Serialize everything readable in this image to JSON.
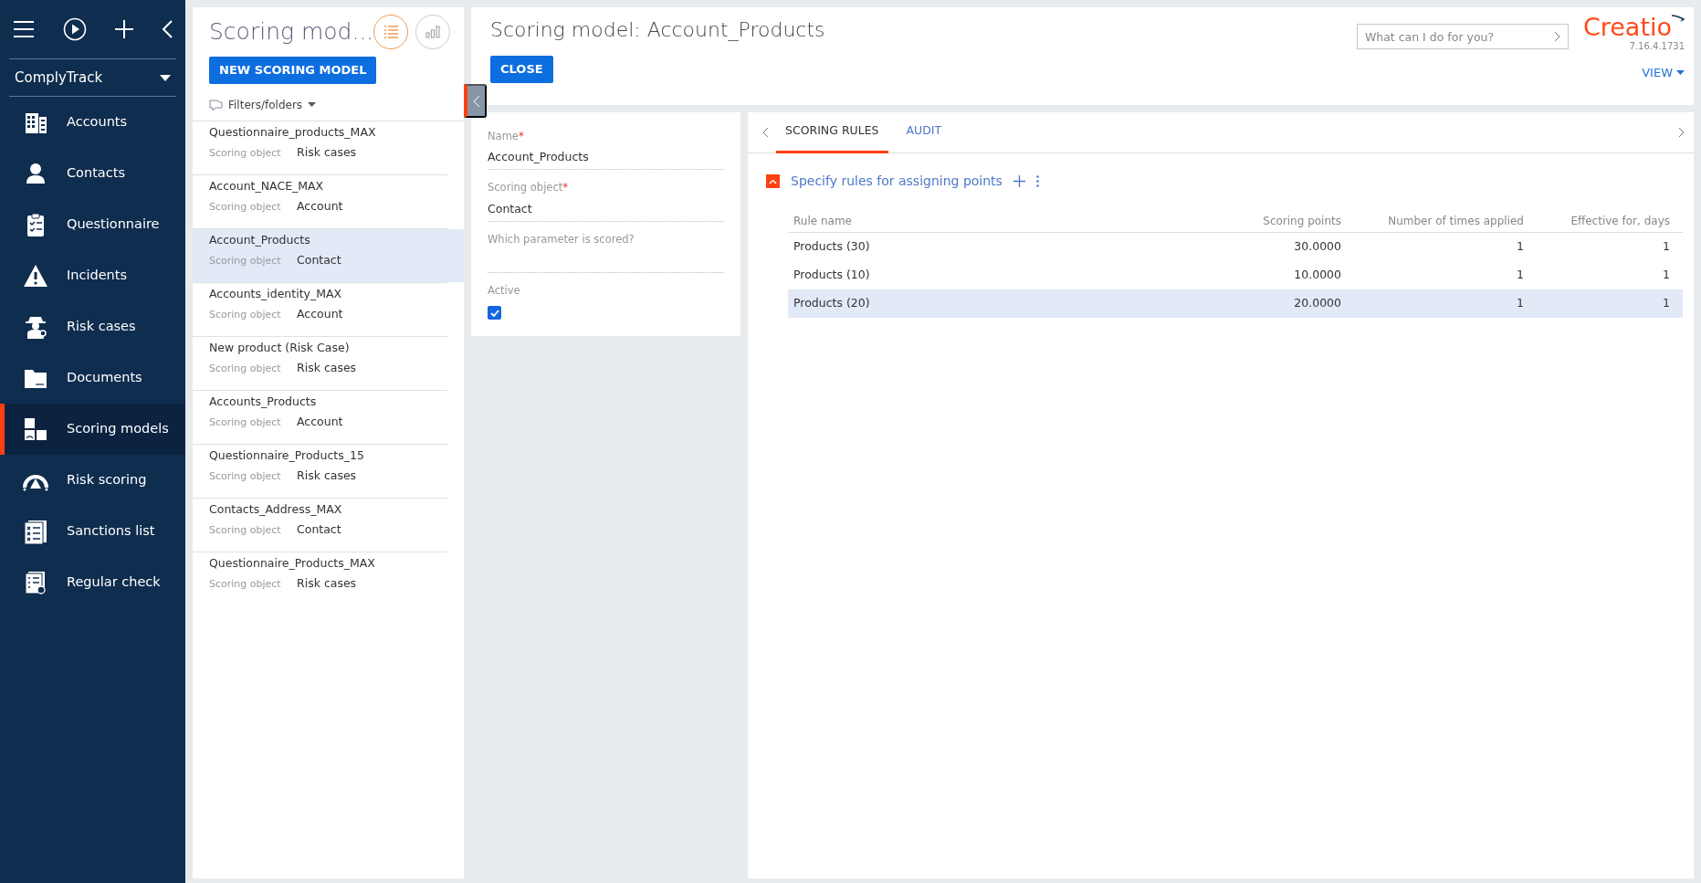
{
  "sidebar": {
    "workspace": "ComplyTrack",
    "items": [
      {
        "label": "Accounts",
        "selected": false
      },
      {
        "label": "Contacts",
        "selected": false
      },
      {
        "label": "Questionnaire",
        "selected": false
      },
      {
        "label": "Incidents",
        "selected": false
      },
      {
        "label": "Risk cases",
        "selected": false
      },
      {
        "label": "Documents",
        "selected": false
      },
      {
        "label": "Scoring models",
        "selected": true
      },
      {
        "label": "Risk scoring",
        "selected": false
      },
      {
        "label": "Sanctions list",
        "selected": false
      },
      {
        "label": "Regular check",
        "selected": false
      }
    ]
  },
  "list_panel": {
    "title": "Scoring mod...",
    "views": [
      {
        "selected": true
      },
      {
        "selected": false
      }
    ],
    "new_button": "NEW SCORING MODEL",
    "filters": "Filters/folders",
    "records": [
      {
        "name": "Questionnaire_products_MAX",
        "field_label": "Scoring object",
        "value": "Risk cases",
        "selected": false
      },
      {
        "name": "Account_NACE_MAX",
        "field_label": "Scoring object",
        "value": "Account",
        "selected": false
      },
      {
        "name": "Account_Products",
        "field_label": "Scoring object",
        "value": "Contact",
        "selected": true
      },
      {
        "name": "Accounts_identity_MAX",
        "field_label": "Scoring object",
        "value": "Account",
        "selected": false
      },
      {
        "name": "New product (Risk Case)",
        "field_label": "Scoring object",
        "value": "Risk cases",
        "selected": false
      },
      {
        "name": "Accounts_Products",
        "field_label": "Scoring object",
        "value": "Account",
        "selected": false
      },
      {
        "name": "Questionnaire_Products_15",
        "field_label": "Scoring object",
        "value": "Risk cases",
        "selected": false
      },
      {
        "name": "Contacts_Address_MAX",
        "field_label": "Scoring object",
        "value": "Contact",
        "selected": false
      },
      {
        "name": "Questionnaire_Products_MAX",
        "field_label": "Scoring object",
        "value": "Risk cases",
        "selected": false
      }
    ]
  },
  "header": {
    "title": "Scoring model: Account_Products",
    "close_button": "CLOSE",
    "search": {
      "placeholder": "What can I do for you?"
    },
    "logo": "Creatio",
    "version": "7.16.4.1731",
    "view_menu": "VIEW"
  },
  "form": {
    "fields": [
      {
        "label": "Name",
        "required_mark": "*",
        "value": "Account_Products"
      },
      {
        "label": "Scoring object",
        "required_mark": "*",
        "value": "Contact"
      },
      {
        "label": "Which parameter is scored?"
      }
    ],
    "active": {
      "label": "Active",
      "checked": true
    }
  },
  "detail": {
    "tabs": [
      {
        "label": "SCORING RULES",
        "selected": true
      },
      {
        "label": "AUDIT",
        "selected": false
      }
    ],
    "group": {
      "title": "Specify rules for assigning points",
      "expanded": true
    },
    "table": {
      "columns": [
        "Rule name",
        "Scoring points",
        "Number of times applied",
        "Effective for, days"
      ],
      "rows": [
        {
          "cells": [
            "Products (30)",
            "30.0000",
            "1",
            "1"
          ],
          "selected": false
        },
        {
          "cells": [
            "Products (10)",
            "10.0000",
            "1",
            "1"
          ],
          "selected": false
        },
        {
          "cells": [
            "Products (20)",
            "20.0000",
            "1",
            "1"
          ],
          "selected": true
        }
      ]
    }
  }
}
